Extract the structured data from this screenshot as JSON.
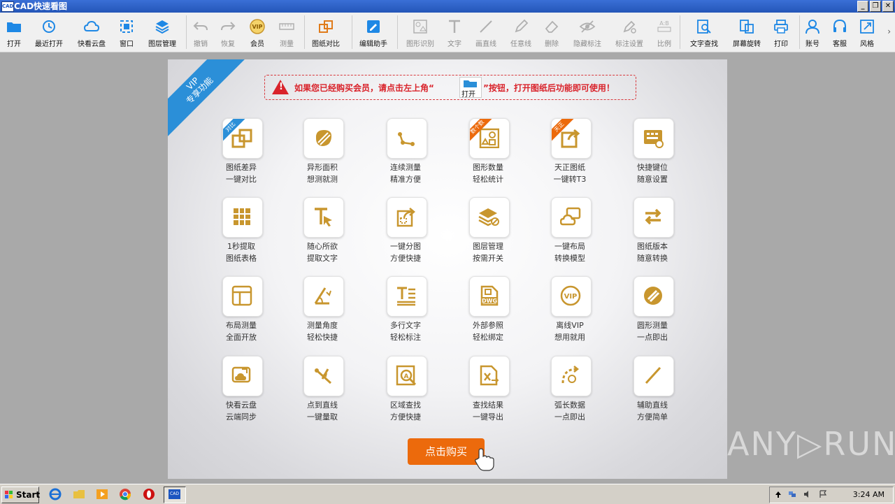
{
  "window": {
    "title": "CAD快速看图",
    "app_icon_text": "CAD",
    "buttons": [
      "_",
      "❐",
      "✕"
    ]
  },
  "toolbar": {
    "items": [
      {
        "name": "open",
        "label": "打开",
        "icon": "folder-icon",
        "disabled": false
      },
      {
        "name": "recent",
        "label": "最近打开",
        "icon": "clock-icon",
        "disabled": false
      },
      {
        "name": "cloud",
        "label": "快看云盘",
        "icon": "cloud-icon",
        "disabled": false
      },
      {
        "name": "window",
        "label": "窗口",
        "icon": "window-icon",
        "disabled": false
      },
      {
        "name": "layers",
        "label": "图层管理",
        "icon": "layers-icon",
        "disabled": false
      },
      {
        "name": "undo",
        "label": "撤销",
        "icon": "undo-icon",
        "disabled": true
      },
      {
        "name": "redo",
        "label": "恢复",
        "icon": "redo-icon",
        "disabled": true
      },
      {
        "name": "vip",
        "label": "会员",
        "icon": "vip-icon",
        "disabled": false
      },
      {
        "name": "measure",
        "label": "测量",
        "icon": "ruler-icon",
        "disabled": true
      },
      {
        "name": "compare",
        "label": "图纸对比",
        "icon": "compare-icon",
        "disabled": false
      },
      {
        "name": "edit",
        "label": "编辑助手",
        "icon": "edit-assistant-icon",
        "disabled": false
      },
      {
        "name": "shape-recognize",
        "label": "图形识别",
        "icon": "shape-recognize-icon",
        "disabled": true
      },
      {
        "name": "text",
        "label": "文字",
        "icon": "text-icon",
        "disabled": true
      },
      {
        "name": "line",
        "label": "画直线",
        "icon": "line-icon",
        "disabled": true
      },
      {
        "name": "freeline",
        "label": "任意线",
        "icon": "pen-icon",
        "disabled": true
      },
      {
        "name": "delete",
        "label": "删除",
        "icon": "eraser-icon",
        "disabled": true
      },
      {
        "name": "hide-annot",
        "label": "隐藏标注",
        "icon": "eye-hidden-icon",
        "disabled": true
      },
      {
        "name": "annot-settings",
        "label": "标注设置",
        "icon": "annotation-settings-icon",
        "disabled": true
      },
      {
        "name": "scale",
        "label": "比例",
        "icon": "scale-icon",
        "disabled": true
      },
      {
        "name": "find-text",
        "label": "文字查找",
        "icon": "find-text-icon",
        "disabled": false
      },
      {
        "name": "rotate",
        "label": "屏幕旋转",
        "icon": "rotate-icon",
        "disabled": false
      },
      {
        "name": "print",
        "label": "打印",
        "icon": "printer-icon",
        "disabled": false
      },
      {
        "name": "account",
        "label": "账号",
        "icon": "user-icon",
        "disabled": false
      },
      {
        "name": "service",
        "label": "客服",
        "icon": "headset-icon",
        "disabled": false
      },
      {
        "name": "style",
        "label": "风格",
        "icon": "style-icon",
        "disabled": false
      }
    ],
    "more": "›"
  },
  "panel": {
    "ribbon": {
      "line1": "VIP",
      "line2": "专享功能"
    },
    "notice": {
      "before": "如果您已经购买会员，请点击左上角“",
      "open_label": "打开",
      "after": "”按钮，打开图纸后功能即可使用！"
    },
    "features": [
      {
        "l1": "图纸差异",
        "l2": "一键对比",
        "icon": "compare-icon",
        "tag": "对比",
        "tag_color": "#2b8fd8"
      },
      {
        "l1": "异形面积",
        "l2": "想测就测",
        "icon": "irregular-area-icon",
        "tag": ""
      },
      {
        "l1": "连续测量",
        "l2": "精准方便",
        "icon": "continuous-measure-icon",
        "tag": ""
      },
      {
        "l1": "图形数量",
        "l2": "轻松统计",
        "icon": "shape-count-icon",
        "tag": "数个数",
        "tag_color": "#ec6a0c"
      },
      {
        "l1": "天正图纸",
        "l2": "一键转T3",
        "icon": "export-icon",
        "tag": "天正",
        "tag_color": "#ec6a0c"
      },
      {
        "l1": "快捷键位",
        "l2": "随意设置",
        "icon": "keyboard-icon",
        "tag": ""
      },
      {
        "l1": "1秒提取",
        "l2": "图纸表格",
        "icon": "table-icon",
        "tag": ""
      },
      {
        "l1": "随心所欲",
        "l2": "提取文字",
        "icon": "text-extract-icon",
        "tag": ""
      },
      {
        "l1": "一键分图",
        "l2": "方便快捷",
        "icon": "split-icon",
        "tag": ""
      },
      {
        "l1": "图层管理",
        "l2": "按需开关",
        "icon": "layers-icon",
        "tag": ""
      },
      {
        "l1": "一键布局",
        "l2": "转换模型",
        "icon": "layout-convert-icon",
        "tag": ""
      },
      {
        "l1": "图纸版本",
        "l2": "随意转换",
        "icon": "version-convert-icon",
        "tag": ""
      },
      {
        "l1": "布局测量",
        "l2": "全面开放",
        "icon": "layout-measure-icon",
        "tag": ""
      },
      {
        "l1": "测量角度",
        "l2": "轻松快捷",
        "icon": "angle-icon",
        "tag": ""
      },
      {
        "l1": "多行文字",
        "l2": "轻松标注",
        "icon": "multiline-text-icon",
        "tag": ""
      },
      {
        "l1": "外部参照",
        "l2": "轻松绑定",
        "icon": "dwg-icon",
        "tag": ""
      },
      {
        "l1": "离线VIP",
        "l2": "想用就用",
        "icon": "vip-icon",
        "tag": ""
      },
      {
        "l1": "圆形测量",
        "l2": "一点即出",
        "icon": "circle-measure-icon",
        "tag": ""
      },
      {
        "l1": "快看云盘",
        "l2": "云端同步",
        "icon": "cloud-sync-icon",
        "tag": ""
      },
      {
        "l1": "点到直线",
        "l2": "一键量取",
        "icon": "point-line-icon",
        "tag": ""
      },
      {
        "l1": "区域查找",
        "l2": "方便快捷",
        "icon": "area-search-icon",
        "tag": ""
      },
      {
        "l1": "查找结果",
        "l2": "一键导出",
        "icon": "excel-export-icon",
        "tag": ""
      },
      {
        "l1": "弧长数据",
        "l2": "一点即出",
        "icon": "arc-length-icon",
        "tag": ""
      },
      {
        "l1": "辅助直线",
        "l2": "方便简单",
        "icon": "aux-line-icon",
        "tag": ""
      }
    ],
    "buy_label": "点击购买"
  },
  "watermark": "ANY▷RUN",
  "taskbar": {
    "start_label": "Start",
    "clock": "3:24 AM"
  },
  "colors": {
    "accent_gold": "#c8962e",
    "buy_orange": "#ec6a0c",
    "ribbon_blue": "#2b8fd8",
    "warn_red": "#d9232b"
  }
}
